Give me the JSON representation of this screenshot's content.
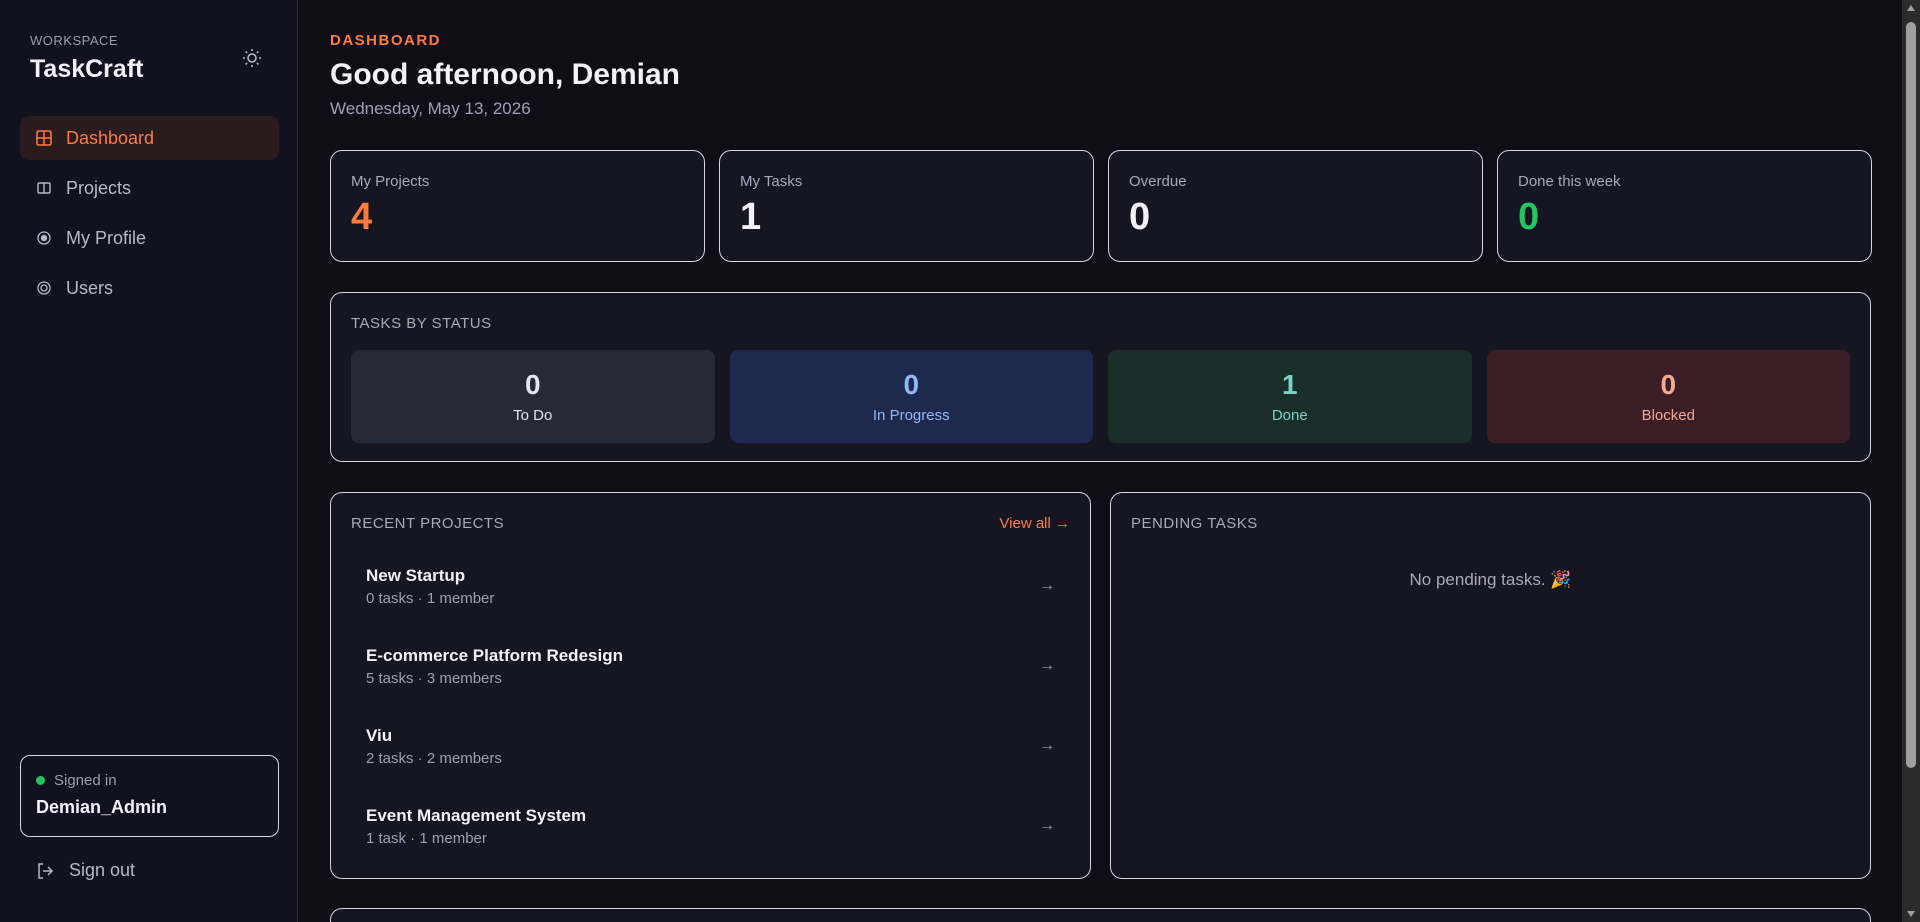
{
  "sidebar": {
    "workspace_label": "WORKSPACE",
    "workspace_name": "TaskCraft",
    "nav": [
      {
        "label": "Dashboard",
        "icon": "grid-icon",
        "active": true
      },
      {
        "label": "Projects",
        "icon": "columns-icon",
        "active": false
      },
      {
        "label": "My Profile",
        "icon": "user-dot-icon",
        "active": false
      },
      {
        "label": "Users",
        "icon": "users-ring-icon",
        "active": false
      }
    ],
    "signed_in_label": "Signed in",
    "signed_in_user": "Demian_Admin",
    "sign_out_label": "Sign out"
  },
  "header": {
    "eyebrow": "DASHBOARD",
    "greeting": "Good afternoon, Demian",
    "date": "Wednesday, May 13, 2026"
  },
  "stats": [
    {
      "label": "My Projects",
      "value": "4",
      "color": "#ff7a3d"
    },
    {
      "label": "My Tasks",
      "value": "1",
      "color": "#f3f2f8"
    },
    {
      "label": "Overdue",
      "value": "0",
      "color": "#f3f2f8"
    },
    {
      "label": "Done this week",
      "value": "0",
      "color": "#22c55e"
    }
  ],
  "tasks_by_status": {
    "title": "TASKS BY STATUS",
    "items": [
      {
        "label": "To Do",
        "value": "0",
        "bg": "#262938",
        "fg": "#e4e3ee"
      },
      {
        "label": "In Progress",
        "value": "0",
        "bg": "#1e2a4d",
        "fg": "#93b8f5"
      },
      {
        "label": "Done",
        "value": "1",
        "bg": "#1a2e2a",
        "fg": "#7fd1c8"
      },
      {
        "label": "Blocked",
        "value": "0",
        "bg": "#3b1e25",
        "fg": "#f4a98f"
      }
    ]
  },
  "recent_projects": {
    "title": "RECENT PROJECTS",
    "view_all": "View all →",
    "items": [
      {
        "name": "New Startup",
        "meta": "0 tasks · 1 member"
      },
      {
        "name": "E-commerce Platform Redesign",
        "meta": "5 tasks · 3 members"
      },
      {
        "name": "Viu",
        "meta": "2 tasks · 2 members"
      },
      {
        "name": "Event Management System",
        "meta": "1 task · 1 member"
      }
    ],
    "arrow": "→"
  },
  "pending_tasks": {
    "title": "PENDING TASKS",
    "empty_text": "No pending tasks. 🎉"
  }
}
